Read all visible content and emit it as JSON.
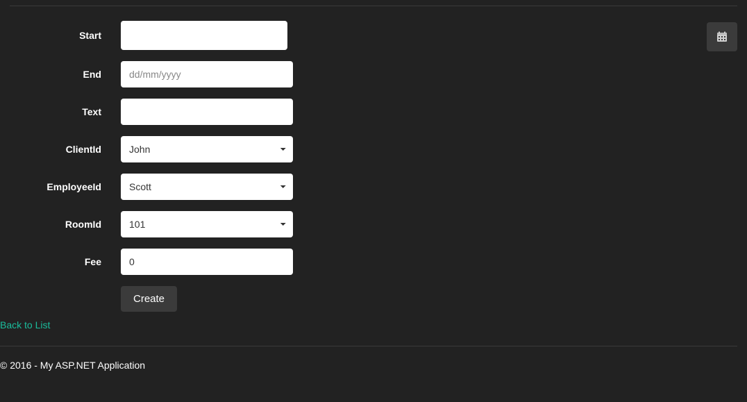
{
  "form": {
    "start": {
      "label": "Start",
      "value": ""
    },
    "end": {
      "label": "End",
      "value": "",
      "placeholder": "dd/mm/yyyy"
    },
    "text": {
      "label": "Text",
      "value": ""
    },
    "client": {
      "label": "ClientId",
      "selected": "John",
      "options": [
        "John"
      ]
    },
    "employee": {
      "label": "EmployeeId",
      "selected": "Scott",
      "options": [
        "Scott"
      ]
    },
    "room": {
      "label": "RoomId",
      "selected": "101",
      "options": [
        "101"
      ]
    },
    "fee": {
      "label": "Fee",
      "value": "0"
    },
    "submit_label": "Create"
  },
  "nav": {
    "back_label": "Back to List"
  },
  "footer": {
    "text": "© 2016 - My ASP.NET Application"
  },
  "icons": {
    "calendar": "calendar-icon"
  }
}
